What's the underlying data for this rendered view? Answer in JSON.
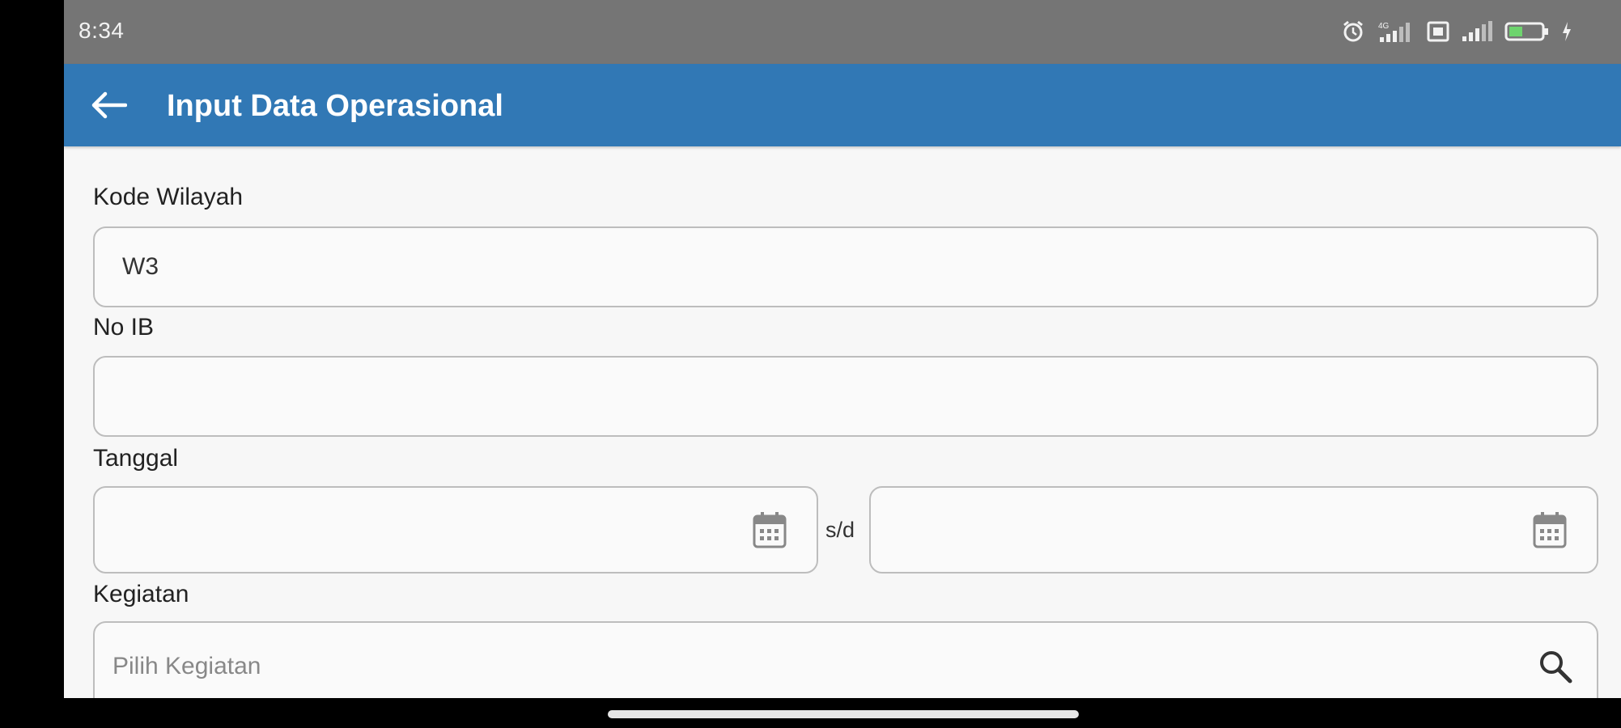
{
  "status_bar": {
    "time": "8:34",
    "icons": [
      "alarm-icon",
      "signal-4g-icon",
      "sim-icon",
      "signal-icon",
      "battery-icon",
      "charging-icon"
    ]
  },
  "app_bar": {
    "title": "Input Data Operasional",
    "background": "#3178b5"
  },
  "form": {
    "kode_wilayah": {
      "label": "Kode Wilayah",
      "value": "W3"
    },
    "no_ib": {
      "label": "No IB",
      "value": ""
    },
    "tanggal": {
      "label": "Tanggal",
      "separator": "s/d",
      "start": "",
      "end": ""
    },
    "kegiatan": {
      "label": "Kegiatan",
      "placeholder": "Pilih Kegiatan"
    }
  }
}
